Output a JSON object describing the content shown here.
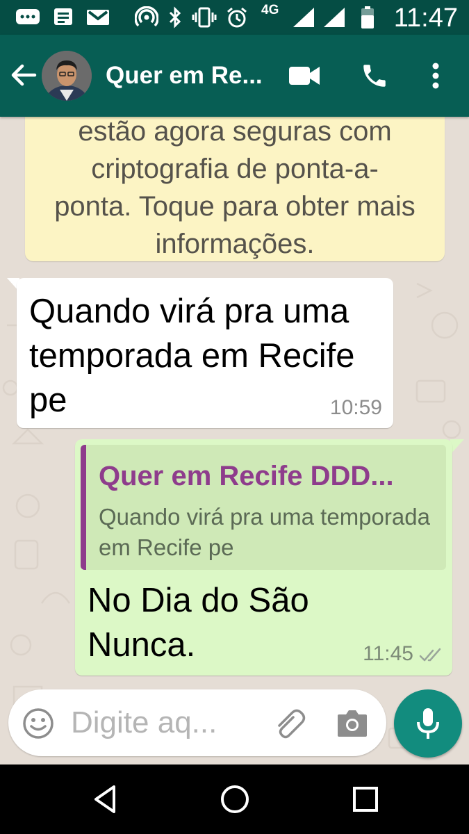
{
  "status_bar": {
    "time": "11:47",
    "network": "4G",
    "icons": [
      "chat-notification-icon",
      "sms-icon",
      "gmail-icon",
      "hotspot-icon",
      "bluetooth-icon",
      "vibrate-icon",
      "alarm-icon",
      "signal-icon",
      "signal-icon",
      "battery-icon"
    ]
  },
  "app_bar": {
    "title": "Quer em Re...",
    "icons": [
      "back-arrow-icon",
      "video-call-icon",
      "phone-call-icon",
      "more-options-icon"
    ]
  },
  "chat": {
    "system_message": "estão agora seguras com criptografia de ponta-a-ponta. Toque para obter mais informações.",
    "messages": [
      {
        "direction": "incoming",
        "text": "Quando virá pra uma temporada em Recife pe",
        "time": "10:59"
      },
      {
        "direction": "outgoing",
        "quote_name": "Quer em Recife DDD...",
        "quote_text": "Quando virá pra uma temporada em Recife pe",
        "text": "No Dia do São Nunca.",
        "time": "11:45",
        "status": "delivered-ticks-icon"
      }
    ]
  },
  "composer": {
    "placeholder": "Digite aq..."
  },
  "colors": {
    "header": "#075e54",
    "status_bar": "#054d44",
    "outgoing_bubble": "#dcf8c6",
    "system_bubble": "#fcf4c4",
    "quote_accent": "#8e3c8c",
    "mic_button": "#128c7e"
  }
}
